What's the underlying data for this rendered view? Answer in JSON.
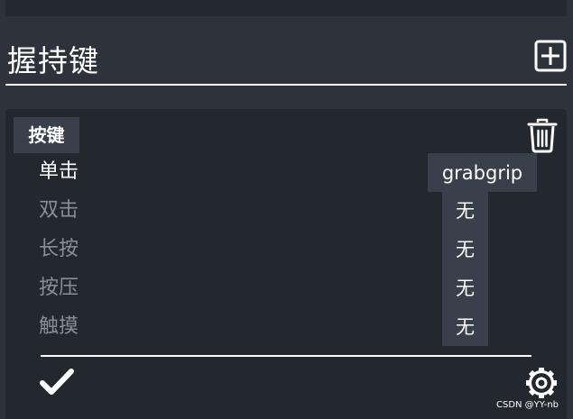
{
  "section": {
    "title": "握持键"
  },
  "binding": {
    "key_label": "按键",
    "actions": [
      {
        "label": "单击",
        "value": "grabgrip",
        "active": true
      },
      {
        "label": "双击",
        "value": "无",
        "active": false
      },
      {
        "label": "长按",
        "value": "无",
        "active": false
      },
      {
        "label": "按压",
        "value": "无",
        "active": false
      },
      {
        "label": "触摸",
        "value": "无",
        "active": false
      }
    ]
  },
  "icons": {
    "add": "plus-square-icon",
    "delete": "trash-icon",
    "confirm": "checkmark-icon",
    "settings": "gear-icon"
  },
  "colors": {
    "background": "#2d323b",
    "card": "#23272e",
    "chip": "#3a404b",
    "text_active": "#ffffff",
    "text_inactive": "#8a8e95"
  },
  "watermark": "CSDN @YY-nb"
}
